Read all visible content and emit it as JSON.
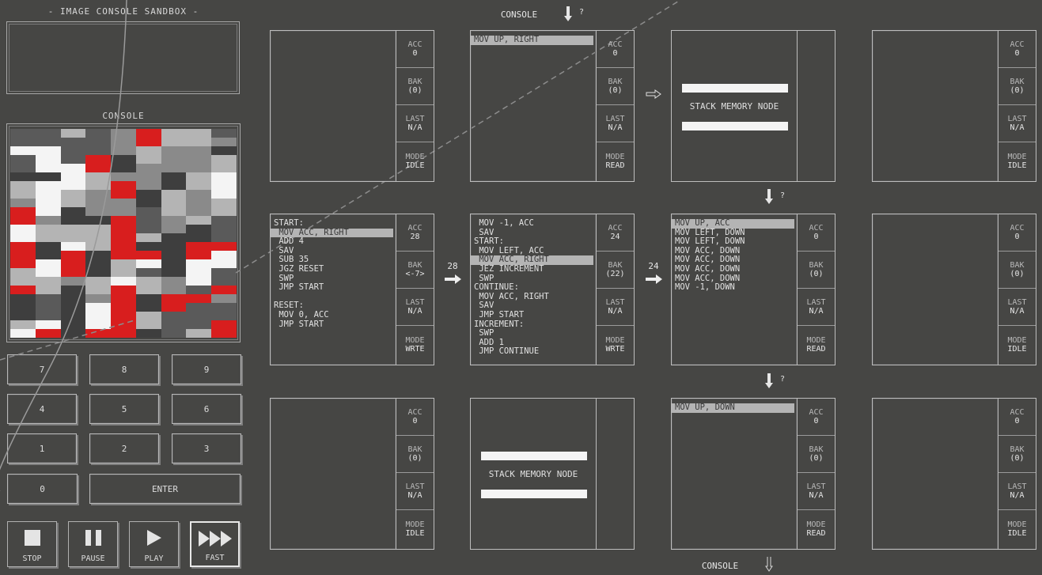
{
  "sandbox": {
    "title": "- IMAGE CONSOLE SANDBOX -",
    "console_label": "CONSOLE"
  },
  "keypad": {
    "keys": [
      "7",
      "8",
      "9",
      "4",
      "5",
      "6",
      "1",
      "2",
      "3",
      "0"
    ],
    "enter_label": "ENTER"
  },
  "controls": {
    "stop": "STOP",
    "pause": "PAUSE",
    "play": "PLAY",
    "fast": "FAST"
  },
  "top_console": {
    "label": "CONSOLE",
    "q": "?"
  },
  "bottom_console": {
    "label": "CONSOLE"
  },
  "ports": {
    "q": "?",
    "left_val": "28",
    "right_val": "24"
  },
  "reg_labels": {
    "acc": "ACC",
    "bak": "BAK",
    "last": "LAST",
    "mode": "MODE"
  },
  "nodes": {
    "r0c0": {
      "acc": "0",
      "bak": "(0)",
      "last": "N/A",
      "mode": "IDLE",
      "lines": [],
      "hl": -1
    },
    "r0c1": {
      "acc": "0",
      "bak": "(0)",
      "last": "N/A",
      "mode": "READ",
      "lines": [
        "MOV UP, RIGHT"
      ],
      "hl": 0
    },
    "r0c3": {
      "acc": "0",
      "bak": "(0)",
      "last": "N/A",
      "mode": "IDLE",
      "lines": [],
      "hl": -1
    },
    "r1c0": {
      "acc": "28",
      "bak": "<-7>",
      "last": "N/A",
      "mode": "WRTE",
      "lines": [
        "START:",
        " MOV ACC, RIGHT",
        " ADD 4",
        " SAV",
        " SUB 35",
        " JGZ RESET",
        " SWP",
        " JMP START",
        "",
        "RESET:",
        " MOV 0, ACC",
        " JMP START"
      ],
      "hl": 1
    },
    "r1c1": {
      "acc": "24",
      "bak": "(22)",
      "last": "N/A",
      "mode": "WRTE",
      "lines": [
        " MOV -1, ACC",
        " SAV",
        "START:",
        " MOV LEFT, ACC",
        " MOV ACC, RIGHT",
        " JEZ INCREMENT",
        " SWP",
        "CONTINUE:",
        " MOV ACC, RIGHT",
        " SAV",
        " JMP START",
        "INCREMENT:",
        " SWP",
        " ADD 1",
        " JMP CONTINUE"
      ],
      "hl": 4
    },
    "r1c2": {
      "acc": "0",
      "bak": "(0)",
      "last": "N/A",
      "mode": "READ",
      "lines": [
        "MOV UP, ACC",
        "MOV LEFT, DOWN",
        "MOV LEFT, DOWN",
        "MOV ACC, DOWN",
        "MOV ACC, DOWN",
        "MOV ACC, DOWN",
        "MOV ACC, DOWN",
        "MOV -1, DOWN"
      ],
      "hl": 0
    },
    "r1c3": {
      "acc": "0",
      "bak": "(0)",
      "last": "N/A",
      "mode": "IDLE",
      "lines": [],
      "hl": -1
    },
    "r2c0": {
      "acc": "0",
      "bak": "(0)",
      "last": "N/A",
      "mode": "IDLE",
      "lines": [],
      "hl": -1
    },
    "r2c2": {
      "acc": "0",
      "bak": "(0)",
      "last": "N/A",
      "mode": "READ",
      "lines": [
        "MOV UP, DOWN"
      ],
      "hl": 0
    },
    "r2c3": {
      "acc": "0",
      "bak": "(0)",
      "last": "N/A",
      "mode": "IDLE",
      "lines": [],
      "hl": -1
    }
  },
  "stack_label": "STACK MEMORY NODE",
  "colors": {
    "bg": "#464644",
    "red": "#d81e1e",
    "white": "#f4f4f4",
    "light": "#b4b4b4",
    "dark": "#5a5a5a"
  }
}
